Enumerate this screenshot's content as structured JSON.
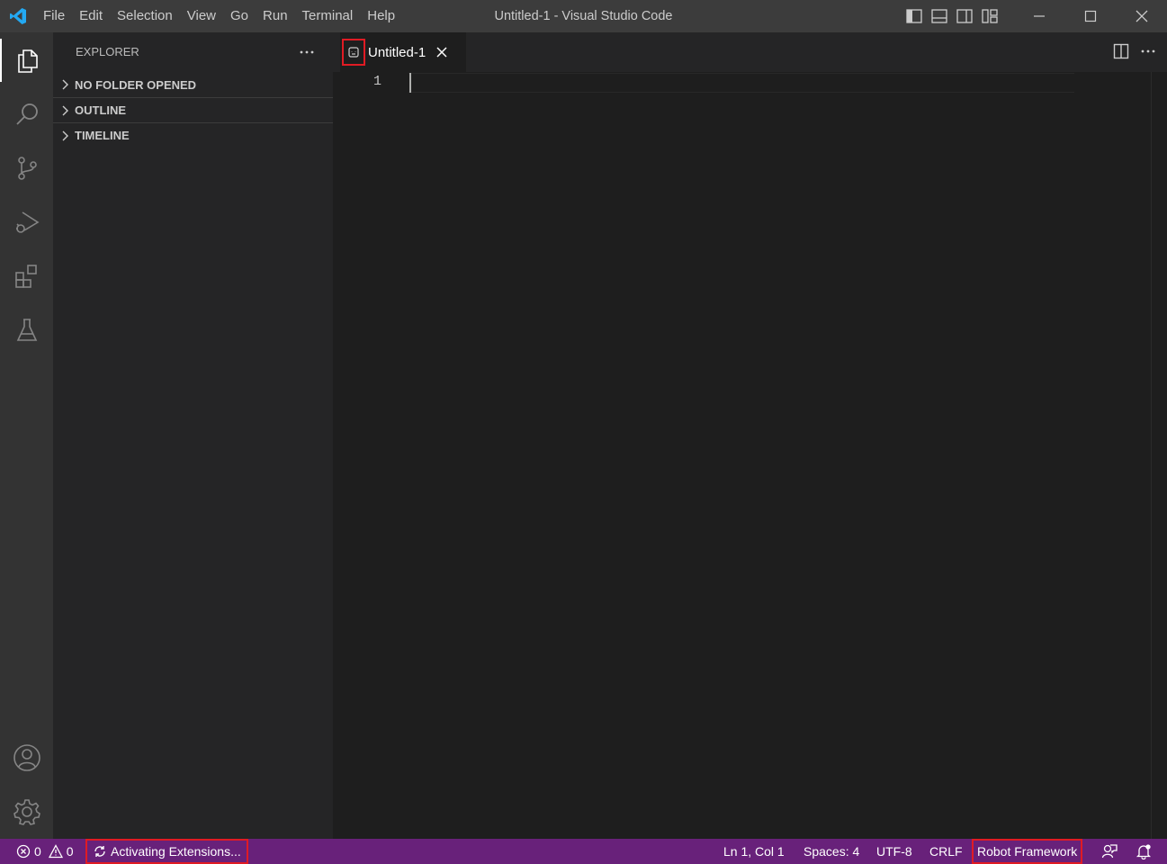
{
  "window_title": "Untitled-1 - Visual Studio Code",
  "menu": [
    "File",
    "Edit",
    "Selection",
    "View",
    "Go",
    "Run",
    "Terminal",
    "Help"
  ],
  "icons": {
    "logo": "vscode-logo",
    "layout": [
      "toggle-primary-sidebar-icon",
      "toggle-panel-icon",
      "toggle-secondary-sidebar-icon",
      "customize-layout-icon"
    ],
    "window": [
      "minimize-icon",
      "maximize-icon",
      "close-icon"
    ],
    "activity": [
      "explorer-icon",
      "search-icon",
      "source-control-icon",
      "run-debug-icon",
      "extensions-icon",
      "testing-icon"
    ],
    "activity_bottom": [
      "accounts-icon",
      "manage-gear-icon"
    ]
  },
  "sidebar": {
    "header": "EXPLORER",
    "sections": [
      "NO FOLDER OPENED",
      "OUTLINE",
      "TIMELINE"
    ]
  },
  "editor": {
    "tab_label": "Untitled-1",
    "line_number": "1"
  },
  "statusbar": {
    "errors": "0",
    "warnings": "0",
    "activity": "Activating Extensions...",
    "position": "Ln 1, Col 1",
    "spaces": "Spaces: 4",
    "encoding": "UTF-8",
    "eol": "CRLF",
    "language": "Robot Framework"
  },
  "colors": {
    "statusbar": "#68217a",
    "highlight_box": "#e01b24",
    "vscode_blue": "#23a9f2"
  }
}
